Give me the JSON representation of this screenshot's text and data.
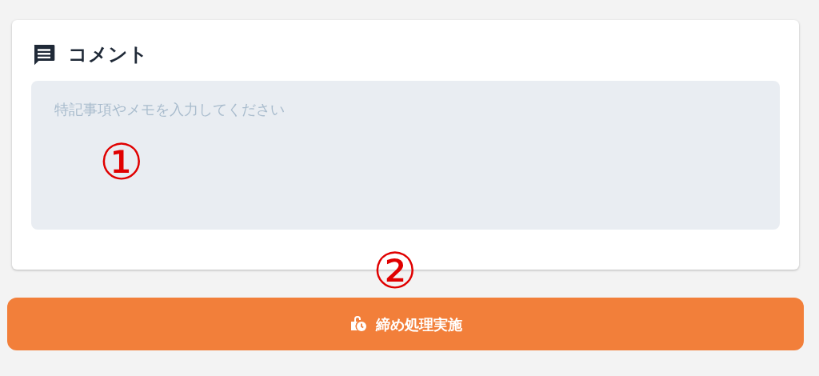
{
  "comment_card": {
    "title": "コメント",
    "textarea": {
      "placeholder": "特記事項やメモを入力してください"
    }
  },
  "annotations": [
    {
      "text": "①"
    },
    {
      "text": "②"
    }
  ],
  "submit_button": {
    "label": "締め処理実施"
  }
}
